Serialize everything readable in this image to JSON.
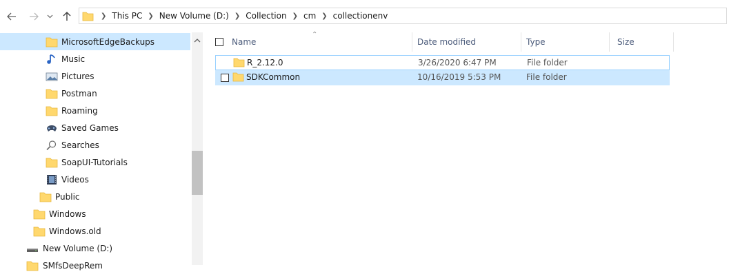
{
  "address": {
    "crumbs": [
      "This PC",
      "New Volume (D:)",
      "Collection",
      "cm",
      "collectionenv"
    ]
  },
  "navigation": {
    "items": [
      {
        "label": "MicrosoftEdgeBackups",
        "icon": "folder-icon",
        "selected": true
      },
      {
        "label": "Music",
        "icon": "music-icon"
      },
      {
        "label": "Pictures",
        "icon": "pictures-icon"
      },
      {
        "label": "Postman",
        "icon": "folder-icon"
      },
      {
        "label": "Roaming",
        "icon": "folder-icon"
      },
      {
        "label": "Saved Games",
        "icon": "saved-games-icon"
      },
      {
        "label": "Searches",
        "icon": "search-icon"
      },
      {
        "label": "SoapUI-Tutorials",
        "icon": "folder-icon"
      },
      {
        "label": "Videos",
        "icon": "videos-icon"
      },
      {
        "label": "Public",
        "icon": "folder-icon"
      },
      {
        "label": "Windows",
        "icon": "folder-icon"
      },
      {
        "label": "Windows.old",
        "icon": "folder-icon"
      },
      {
        "label": "New Volume (D:)",
        "icon": "drive-icon"
      },
      {
        "label": "SMfsDeepRem",
        "icon": "folder-icon"
      }
    ]
  },
  "file_list": {
    "columns": {
      "name": "Name",
      "date_modified": "Date modified",
      "type": "Type",
      "size": "Size"
    },
    "rows": [
      {
        "name": "R_2.12.0",
        "date_modified": "3/26/2020 6:47 PM",
        "type": "File folder",
        "size": "",
        "state": "focused"
      },
      {
        "name": "SDKCommon",
        "date_modified": "10/16/2019 5:53 PM",
        "type": "File folder",
        "size": "",
        "state": "selected"
      }
    ]
  },
  "colors": {
    "selection": "#cce8ff",
    "focus_border": "#99d1ff",
    "folder": "#ffd86e",
    "folder_dark": "#e8b73c"
  }
}
